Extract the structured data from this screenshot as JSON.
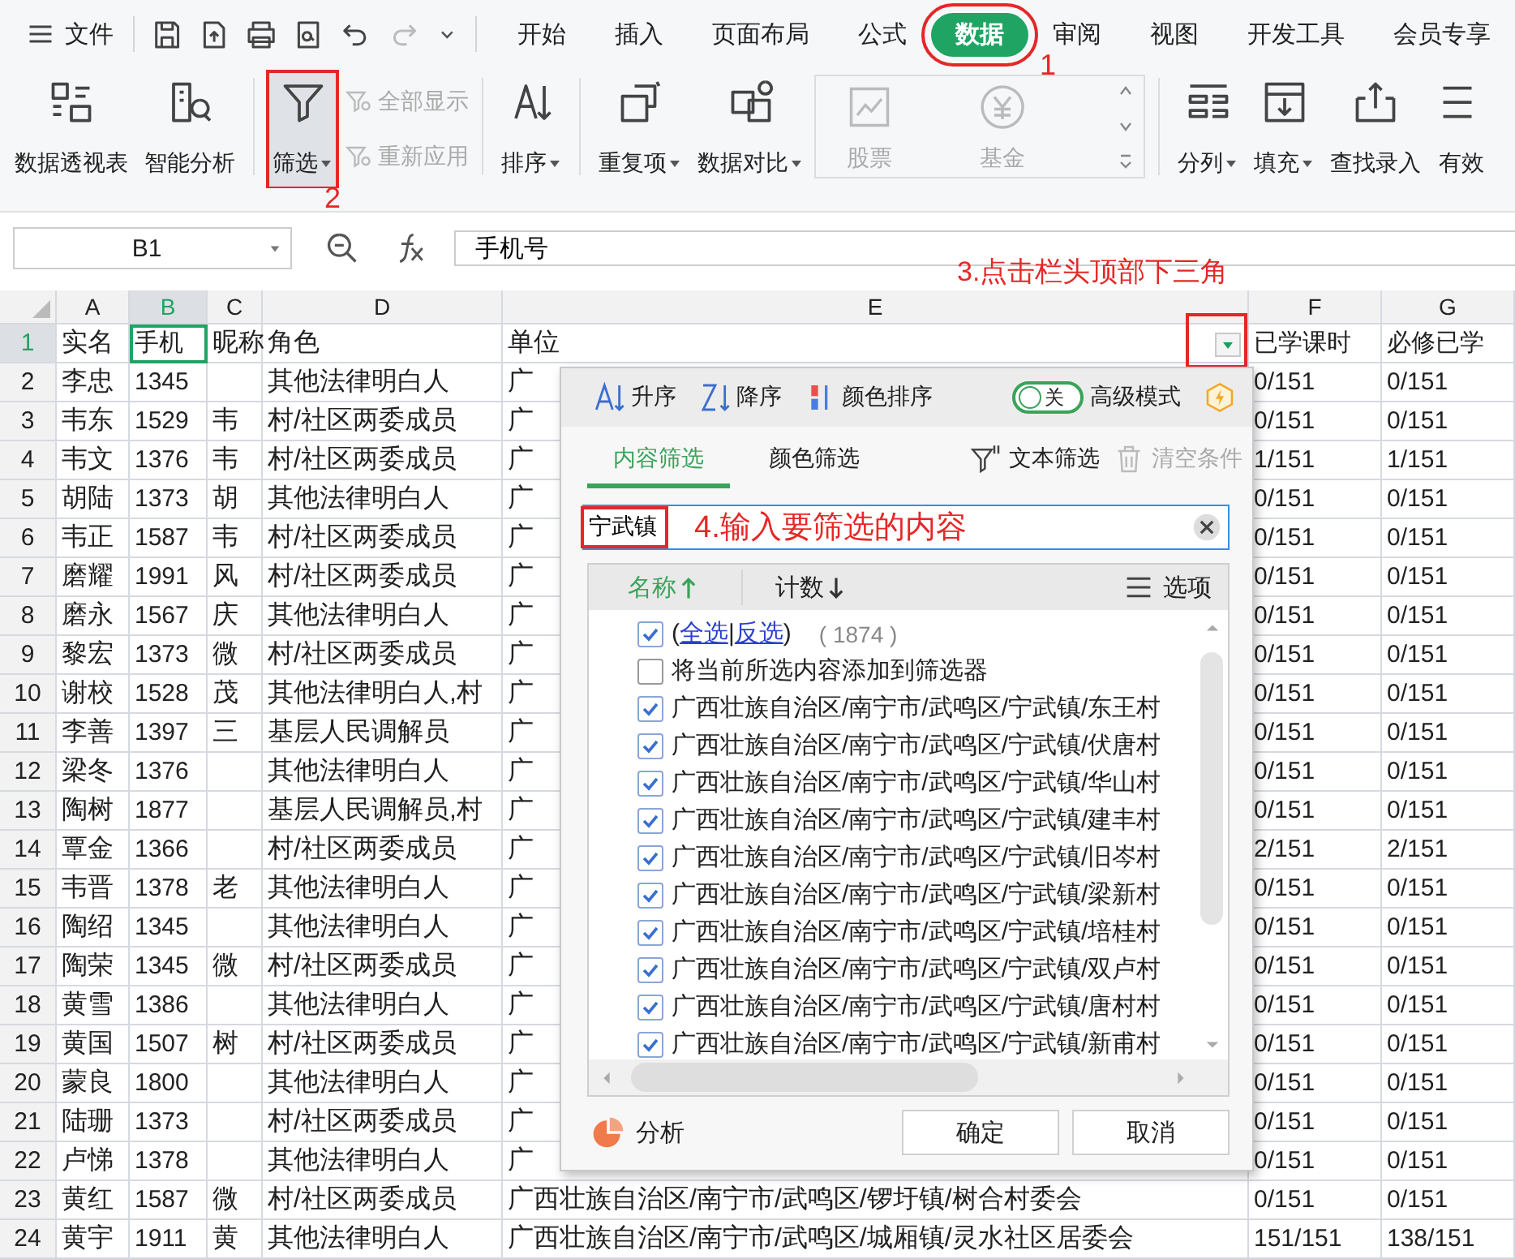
{
  "menu_button": {
    "label": "文件"
  },
  "quick_access": [
    {
      "disabled": false
    },
    {
      "disabled": false
    },
    {
      "disabled": false
    },
    {
      "disabled": false
    },
    {
      "disabled": false
    },
    {
      "disabled": true
    }
  ],
  "tabs": [
    {
      "label": "开始",
      "selected": false,
      "marked": false
    },
    {
      "label": "插入",
      "selected": false,
      "marked": false
    },
    {
      "label": "页面布局",
      "selected": false,
      "marked": false
    },
    {
      "label": "公式",
      "selected": false,
      "marked": false
    },
    {
      "label": "数据",
      "selected": true,
      "marked": true
    },
    {
      "label": "审阅",
      "selected": false,
      "marked": false
    },
    {
      "label": "视图",
      "selected": false,
      "marked": false
    },
    {
      "label": "开发工具",
      "selected": false,
      "marked": false
    },
    {
      "label": "会员专享",
      "selected": false,
      "marked": false
    }
  ],
  "ribbon": [
    [
      {
        "kind": "big",
        "label": "数据透视表",
        "caret": false,
        "marked": false
      },
      {
        "kind": "big",
        "label": "智能分析",
        "caret": false,
        "marked": false
      }
    ],
    [
      {
        "kind": "big",
        "label": "筛选",
        "caret": true,
        "marked": true
      },
      {
        "kind": "stack",
        "items": [
          {
            "label": "全部显示",
            "disabled": true
          },
          {
            "label": "重新应用",
            "disabled": true
          }
        ]
      }
    ],
    [
      {
        "kind": "big",
        "label": "排序",
        "caret": true,
        "marked": false
      }
    ],
    [
      {
        "kind": "big",
        "label": "重复项",
        "caret": true,
        "marked": false
      },
      {
        "kind": "big",
        "label": "数据对比",
        "caret": true,
        "marked": false
      },
      {
        "kind": "panel",
        "items": [
          {
            "label": "股票",
            "disabled": true
          },
          {
            "label": "基金",
            "disabled": true
          }
        ]
      }
    ],
    [
      {
        "kind": "big",
        "label": "分列",
        "caret": true,
        "marked": false
      },
      {
        "kind": "big",
        "label": "填充",
        "caret": true,
        "marked": false
      },
      {
        "kind": "big",
        "label": "查找录入",
        "caret": false,
        "marked": false
      },
      {
        "kind": "big",
        "label": "有效",
        "caret": false,
        "marked": false
      }
    ]
  ],
  "formula_bar": {
    "cell_ref": "B1",
    "formula": "手机号"
  },
  "sheet": {
    "columns": [
      {
        "label": "A",
        "selected": false
      },
      {
        "label": "B",
        "selected": true
      },
      {
        "label": "C",
        "selected": false
      },
      {
        "label": "D",
        "selected": false
      },
      {
        "label": "E",
        "selected": false
      },
      {
        "label": "F",
        "selected": false
      },
      {
        "label": "G",
        "selected": false
      }
    ],
    "filter_button": {
      "marked": true
    },
    "rows": [
      {
        "number": "1",
        "selected": true,
        "a": "实名",
        "b": "手机",
        "c": "昵称",
        "d": "角色",
        "e": "单位",
        "f": "已学课时",
        "g": "必修已学"
      },
      {
        "number": "2",
        "selected": false,
        "a": "李忠",
        "b": "1345",
        "d": "其他法律明白人",
        "e": "广",
        "f": "0/151",
        "g": "0/151"
      },
      {
        "number": "3",
        "selected": false,
        "a": "韦东",
        "b": "1529",
        "c": "韦",
        "d": "村/社区两委成员",
        "e": "广",
        "f": "0/151",
        "g": "0/151"
      },
      {
        "number": "4",
        "selected": false,
        "a": "韦文",
        "b": "1376",
        "c": "韦",
        "d": "村/社区两委成员",
        "e": "广",
        "f": "1/151",
        "g": "1/151"
      },
      {
        "number": "5",
        "selected": false,
        "a": "胡陆",
        "b": "1373",
        "c": "胡",
        "d": "其他法律明白人",
        "e": "广",
        "f": "0/151",
        "g": "0/151"
      },
      {
        "number": "6",
        "selected": false,
        "a": "韦正",
        "b": "1587",
        "c": "韦",
        "d": "村/社区两委成员",
        "e": "广",
        "f": "0/151",
        "g": "0/151"
      },
      {
        "number": "7",
        "selected": false,
        "a": "磨耀",
        "b": "1991",
        "c": "风",
        "d": "村/社区两委成员",
        "e": "广",
        "f": "0/151",
        "g": "0/151"
      },
      {
        "number": "8",
        "selected": false,
        "a": "磨永",
        "b": "1567",
        "c": "庆",
        "d": "其他法律明白人",
        "e": "广",
        "f": "0/151",
        "g": "0/151"
      },
      {
        "number": "9",
        "selected": false,
        "a": "黎宏",
        "b": "1373",
        "c": "微",
        "d": "村/社区两委成员",
        "e": "广",
        "f": "0/151",
        "g": "0/151"
      },
      {
        "number": "10",
        "selected": false,
        "a": "谢校",
        "b": "1528",
        "c": "茂",
        "d": "其他法律明白人,村",
        "e": "广",
        "f": "0/151",
        "g": "0/151"
      },
      {
        "number": "11",
        "selected": false,
        "a": "李善",
        "b": "1397",
        "c": "三",
        "d": "基层人民调解员",
        "e": "广",
        "f": "0/151",
        "g": "0/151"
      },
      {
        "number": "12",
        "selected": false,
        "a": "梁冬",
        "b": "1376",
        "d": "其他法律明白人",
        "e": "广",
        "f": "0/151",
        "g": "0/151"
      },
      {
        "number": "13",
        "selected": false,
        "a": "陶树",
        "b": "1877",
        "d": "基层人民调解员,村",
        "e": "广",
        "f": "0/151",
        "g": "0/151"
      },
      {
        "number": "14",
        "selected": false,
        "a": "覃金",
        "b": "1366",
        "d": "村/社区两委成员",
        "e": "广",
        "f": "2/151",
        "g": "2/151"
      },
      {
        "number": "15",
        "selected": false,
        "a": "韦晋",
        "b": "1378",
        "c": "老",
        "d": "其他法律明白人",
        "e": "广",
        "f": "0/151",
        "g": "0/151"
      },
      {
        "number": "16",
        "selected": false,
        "a": "陶绍",
        "b": "1345",
        "d": "其他法律明白人",
        "e": "广",
        "f": "0/151",
        "g": "0/151"
      },
      {
        "number": "17",
        "selected": false,
        "a": "陶荣",
        "b": "1345",
        "c": "微",
        "d": "村/社区两委成员",
        "e": "广",
        "f": "0/151",
        "g": "0/151"
      },
      {
        "number": "18",
        "selected": false,
        "a": "黄雪",
        "b": "1386",
        "d": "其他法律明白人",
        "e": "广",
        "f": "0/151",
        "g": "0/151"
      },
      {
        "number": "19",
        "selected": false,
        "a": "黄国",
        "b": "1507",
        "c": "树",
        "d": "村/社区两委成员",
        "e": "广",
        "f": "0/151",
        "g": "0/151"
      },
      {
        "number": "20",
        "selected": false,
        "a": "蒙良",
        "b": "1800",
        "d": "其他法律明白人",
        "e": "广",
        "f": "0/151",
        "g": "0/151"
      },
      {
        "number": "21",
        "selected": false,
        "a": "陆珊",
        "b": "1373",
        "d": "村/社区两委成员",
        "e": "广",
        "f": "0/151",
        "g": "0/151"
      },
      {
        "number": "22",
        "selected": false,
        "a": "卢悌",
        "b": "1378",
        "d": "其他法律明白人",
        "e": "广",
        "f": "0/151",
        "g": "0/151"
      },
      {
        "number": "23",
        "selected": false,
        "a": "黄红",
        "b": "1587",
        "c": "微",
        "d": "村/社区两委成员",
        "e": "广西壮族自治区/南宁市/武鸣区/锣圩镇/树合村委会",
        "f": "0/151",
        "g": "0/151"
      },
      {
        "number": "24",
        "selected": false,
        "a": "黄宇",
        "b": "1911",
        "c": "黄",
        "d": "其他法律明白人",
        "e": "广西壮族自治区/南宁市/武鸣区/城厢镇/灵水社区居委会",
        "f": "151/151",
        "g": "138/151"
      }
    ]
  },
  "filter_dialog": {
    "sort_buttons": [
      "升序",
      "降序",
      "颜色排序"
    ],
    "advanced_mode": {
      "on": false,
      "switch_label": "关",
      "label": "高级模式"
    },
    "tabs": [
      {
        "label": "内容筛选",
        "selected": true
      },
      {
        "label": "颜色筛选",
        "selected": false
      }
    ],
    "actions": [
      {
        "label": "文本筛选",
        "disabled": false
      },
      {
        "label": "清空条件",
        "disabled": true
      }
    ],
    "search": {
      "value": "宁武镇",
      "marked": true
    },
    "list_header": {
      "name": "名称",
      "count": "计数",
      "options": "选项"
    },
    "select_all": {
      "checked": true,
      "open": "(",
      "links": [
        "全选",
        "反选"
      ],
      "divider": "|",
      "close": ")",
      "count": "( 1874 )"
    },
    "items": [
      {
        "label": "将当前所选内容添加到筛选器",
        "checked": false
      },
      {
        "label": "广西壮族自治区/南宁市/武鸣区/宁武镇/东王村",
        "checked": true
      },
      {
        "label": "广西壮族自治区/南宁市/武鸣区/宁武镇/伏唐村",
        "checked": true
      },
      {
        "label": "广西壮族自治区/南宁市/武鸣区/宁武镇/华山村",
        "checked": true
      },
      {
        "label": "广西壮族自治区/南宁市/武鸣区/宁武镇/建丰村",
        "checked": true
      },
      {
        "label": "广西壮族自治区/南宁市/武鸣区/宁武镇/旧岑村",
        "checked": true
      },
      {
        "label": "广西壮族自治区/南宁市/武鸣区/宁武镇/梁新村",
        "checked": true
      },
      {
        "label": "广西壮族自治区/南宁市/武鸣区/宁武镇/培桂村",
        "checked": true
      },
      {
        "label": "广西壮族自治区/南宁市/武鸣区/宁武镇/双卢村",
        "checked": true
      },
      {
        "label": "广西壮族自治区/南宁市/武鸣区/宁武镇/唐村村",
        "checked": true
      },
      {
        "label": "广西壮族自治区/南宁市/武鸣区/宁武镇/新甫村",
        "checked": true
      }
    ],
    "analysis": "分析",
    "buttons": [
      "确定",
      "取消"
    ]
  },
  "annotations": [
    {
      "text": "1"
    },
    {
      "text": "2"
    },
    {
      "text": "3.点击栏头顶部下三角"
    },
    {
      "text": "4.输入要筛选的内容"
    }
  ]
}
